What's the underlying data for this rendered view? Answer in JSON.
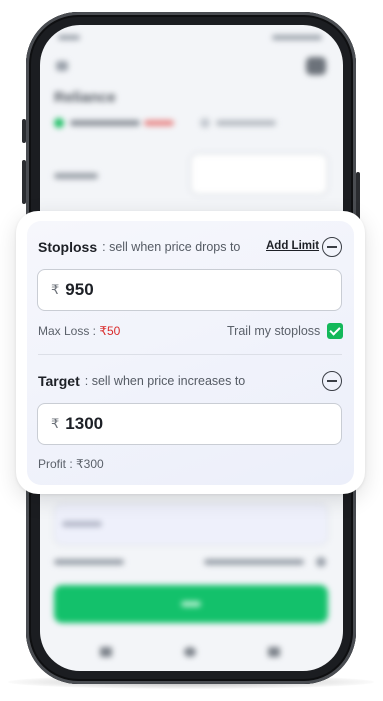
{
  "stoploss": {
    "title": "Stoploss",
    "subtitle": ": sell when price drops to",
    "add_limit": "Add Limit",
    "currency": "₹",
    "value": "950",
    "max_loss_label": "Max Loss : ",
    "max_loss_value": "₹50",
    "trail_label": "Trail my stoploss",
    "trail_checked": true
  },
  "target": {
    "title": "Target",
    "subtitle": ": sell when price increases to",
    "currency": "₹",
    "value": "1300",
    "profit_label": "Profit : ₹300"
  },
  "background_screen": {
    "stock_title": "Reliance"
  },
  "colors": {
    "accent_green": "#14b85a",
    "loss_red": "#d92b2b",
    "buy_button": "#13c16b"
  }
}
